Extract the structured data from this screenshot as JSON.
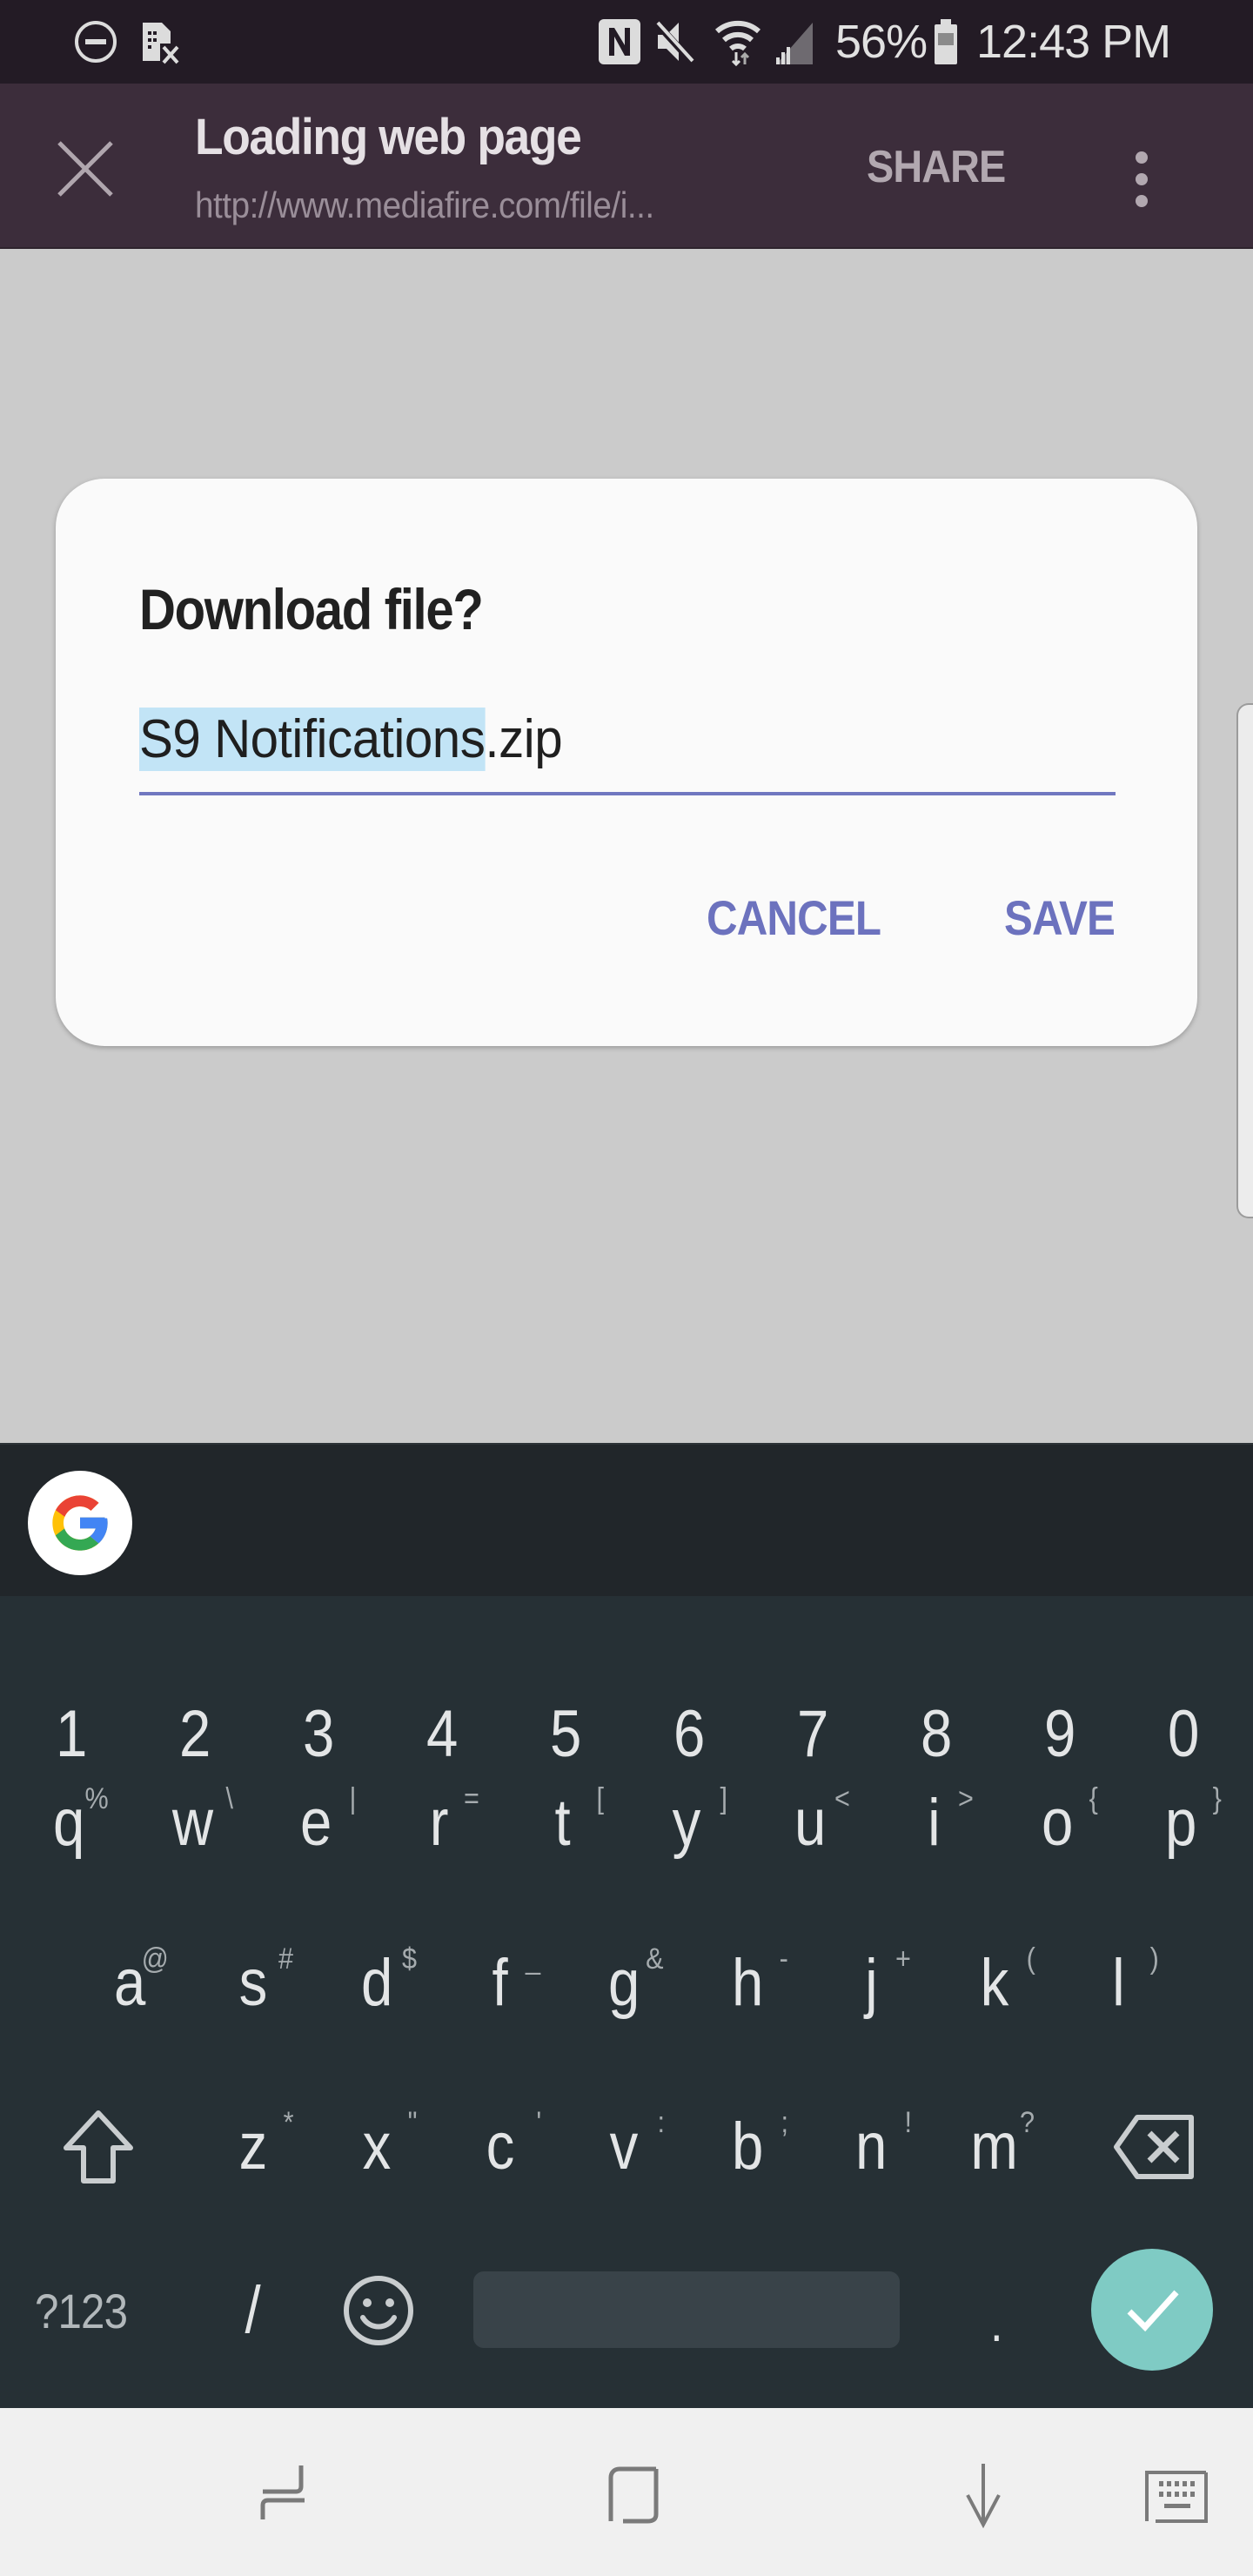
{
  "status_bar": {
    "left_icons": [
      "do-not-disturb-icon",
      "no-sim-icon"
    ],
    "right_icons": [
      "nfc-icon",
      "mute-icon",
      "wifi-icon",
      "signal-icon"
    ],
    "battery_percent": "56%",
    "time": "12:43 PM"
  },
  "app_bar": {
    "close_icon": "close-icon",
    "title": "Loading web page",
    "url": "http://www.mediafire.com/file/i...",
    "share_label": "SHARE",
    "more_icon": "more-vert-icon"
  },
  "dialog": {
    "title": "Download file?",
    "filename": {
      "selected_part": "S9 Notifications",
      "unselected_part": ".zip",
      "full_value": "S9 Notifications.zip"
    },
    "cancel_label": "CANCEL",
    "save_label": "SAVE"
  },
  "keyboard": {
    "suggestion_strip_icon": "google-g-icon",
    "number_row": [
      "1",
      "2",
      "3",
      "4",
      "5",
      "6",
      "7",
      "8",
      "9",
      "0"
    ],
    "row1": [
      {
        "key": "q",
        "hint": "%"
      },
      {
        "key": "w",
        "hint": "\\"
      },
      {
        "key": "e",
        "hint": "|"
      },
      {
        "key": "r",
        "hint": "="
      },
      {
        "key": "t",
        "hint": "["
      },
      {
        "key": "y",
        "hint": "]"
      },
      {
        "key": "u",
        "hint": "<"
      },
      {
        "key": "i",
        "hint": ">"
      },
      {
        "key": "o",
        "hint": "{"
      },
      {
        "key": "p",
        "hint": "}"
      }
    ],
    "row2": [
      {
        "key": "a",
        "hint": "@"
      },
      {
        "key": "s",
        "hint": "#"
      },
      {
        "key": "d",
        "hint": "$"
      },
      {
        "key": "f",
        "hint": "_"
      },
      {
        "key": "g",
        "hint": "&"
      },
      {
        "key": "h",
        "hint": "-"
      },
      {
        "key": "j",
        "hint": "+"
      },
      {
        "key": "k",
        "hint": "("
      },
      {
        "key": "l",
        "hint": ")"
      }
    ],
    "row3": [
      {
        "key": "z",
        "hint": "*"
      },
      {
        "key": "x",
        "hint": "\""
      },
      {
        "key": "c",
        "hint": "'"
      },
      {
        "key": "v",
        "hint": ":"
      },
      {
        "key": "b",
        "hint": ";"
      },
      {
        "key": "n",
        "hint": "!"
      },
      {
        "key": "m",
        "hint": "?"
      }
    ],
    "symbols_label": "?123",
    "slash_key": "/",
    "period_key": ".",
    "shift_icon": "shift-icon",
    "backspace_icon": "backspace-icon",
    "emoji_icon": "emoji-icon",
    "enter_icon": "check-icon",
    "accent_color": "#7fcbc4"
  },
  "nav_bar": {
    "buttons": [
      "recents-icon",
      "home-icon",
      "back-icon",
      "keyboard-switch-icon"
    ]
  },
  "colors": {
    "status_bar_bg": "#231b25",
    "app_bar_bg": "#3c2d3b",
    "dialog_accent": "#6c72be",
    "selection_bg": "#c2e4f6",
    "keyboard_bg": "#263035"
  }
}
